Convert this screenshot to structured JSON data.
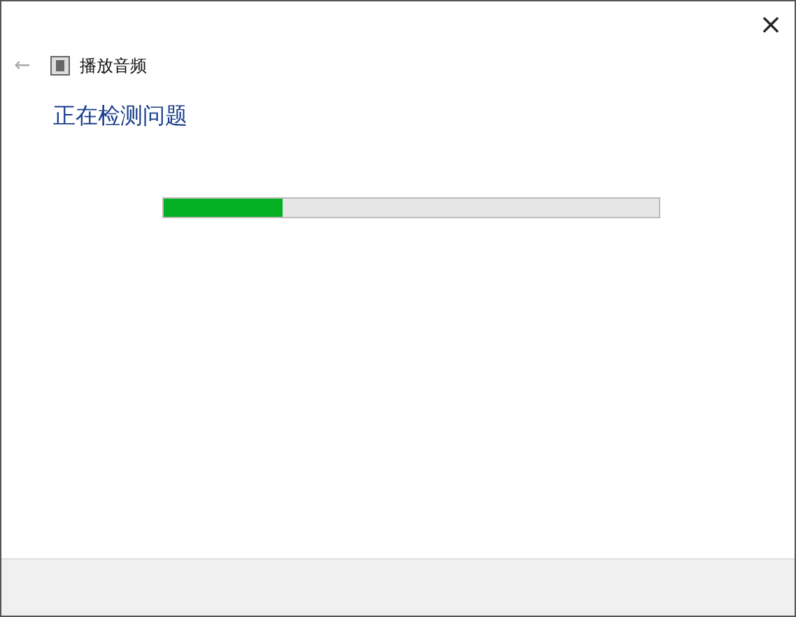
{
  "window": {
    "close": "×",
    "back": "←",
    "title": "播放音频"
  },
  "heading": "正在检测问题",
  "progress": {
    "level": 0.24
  }
}
